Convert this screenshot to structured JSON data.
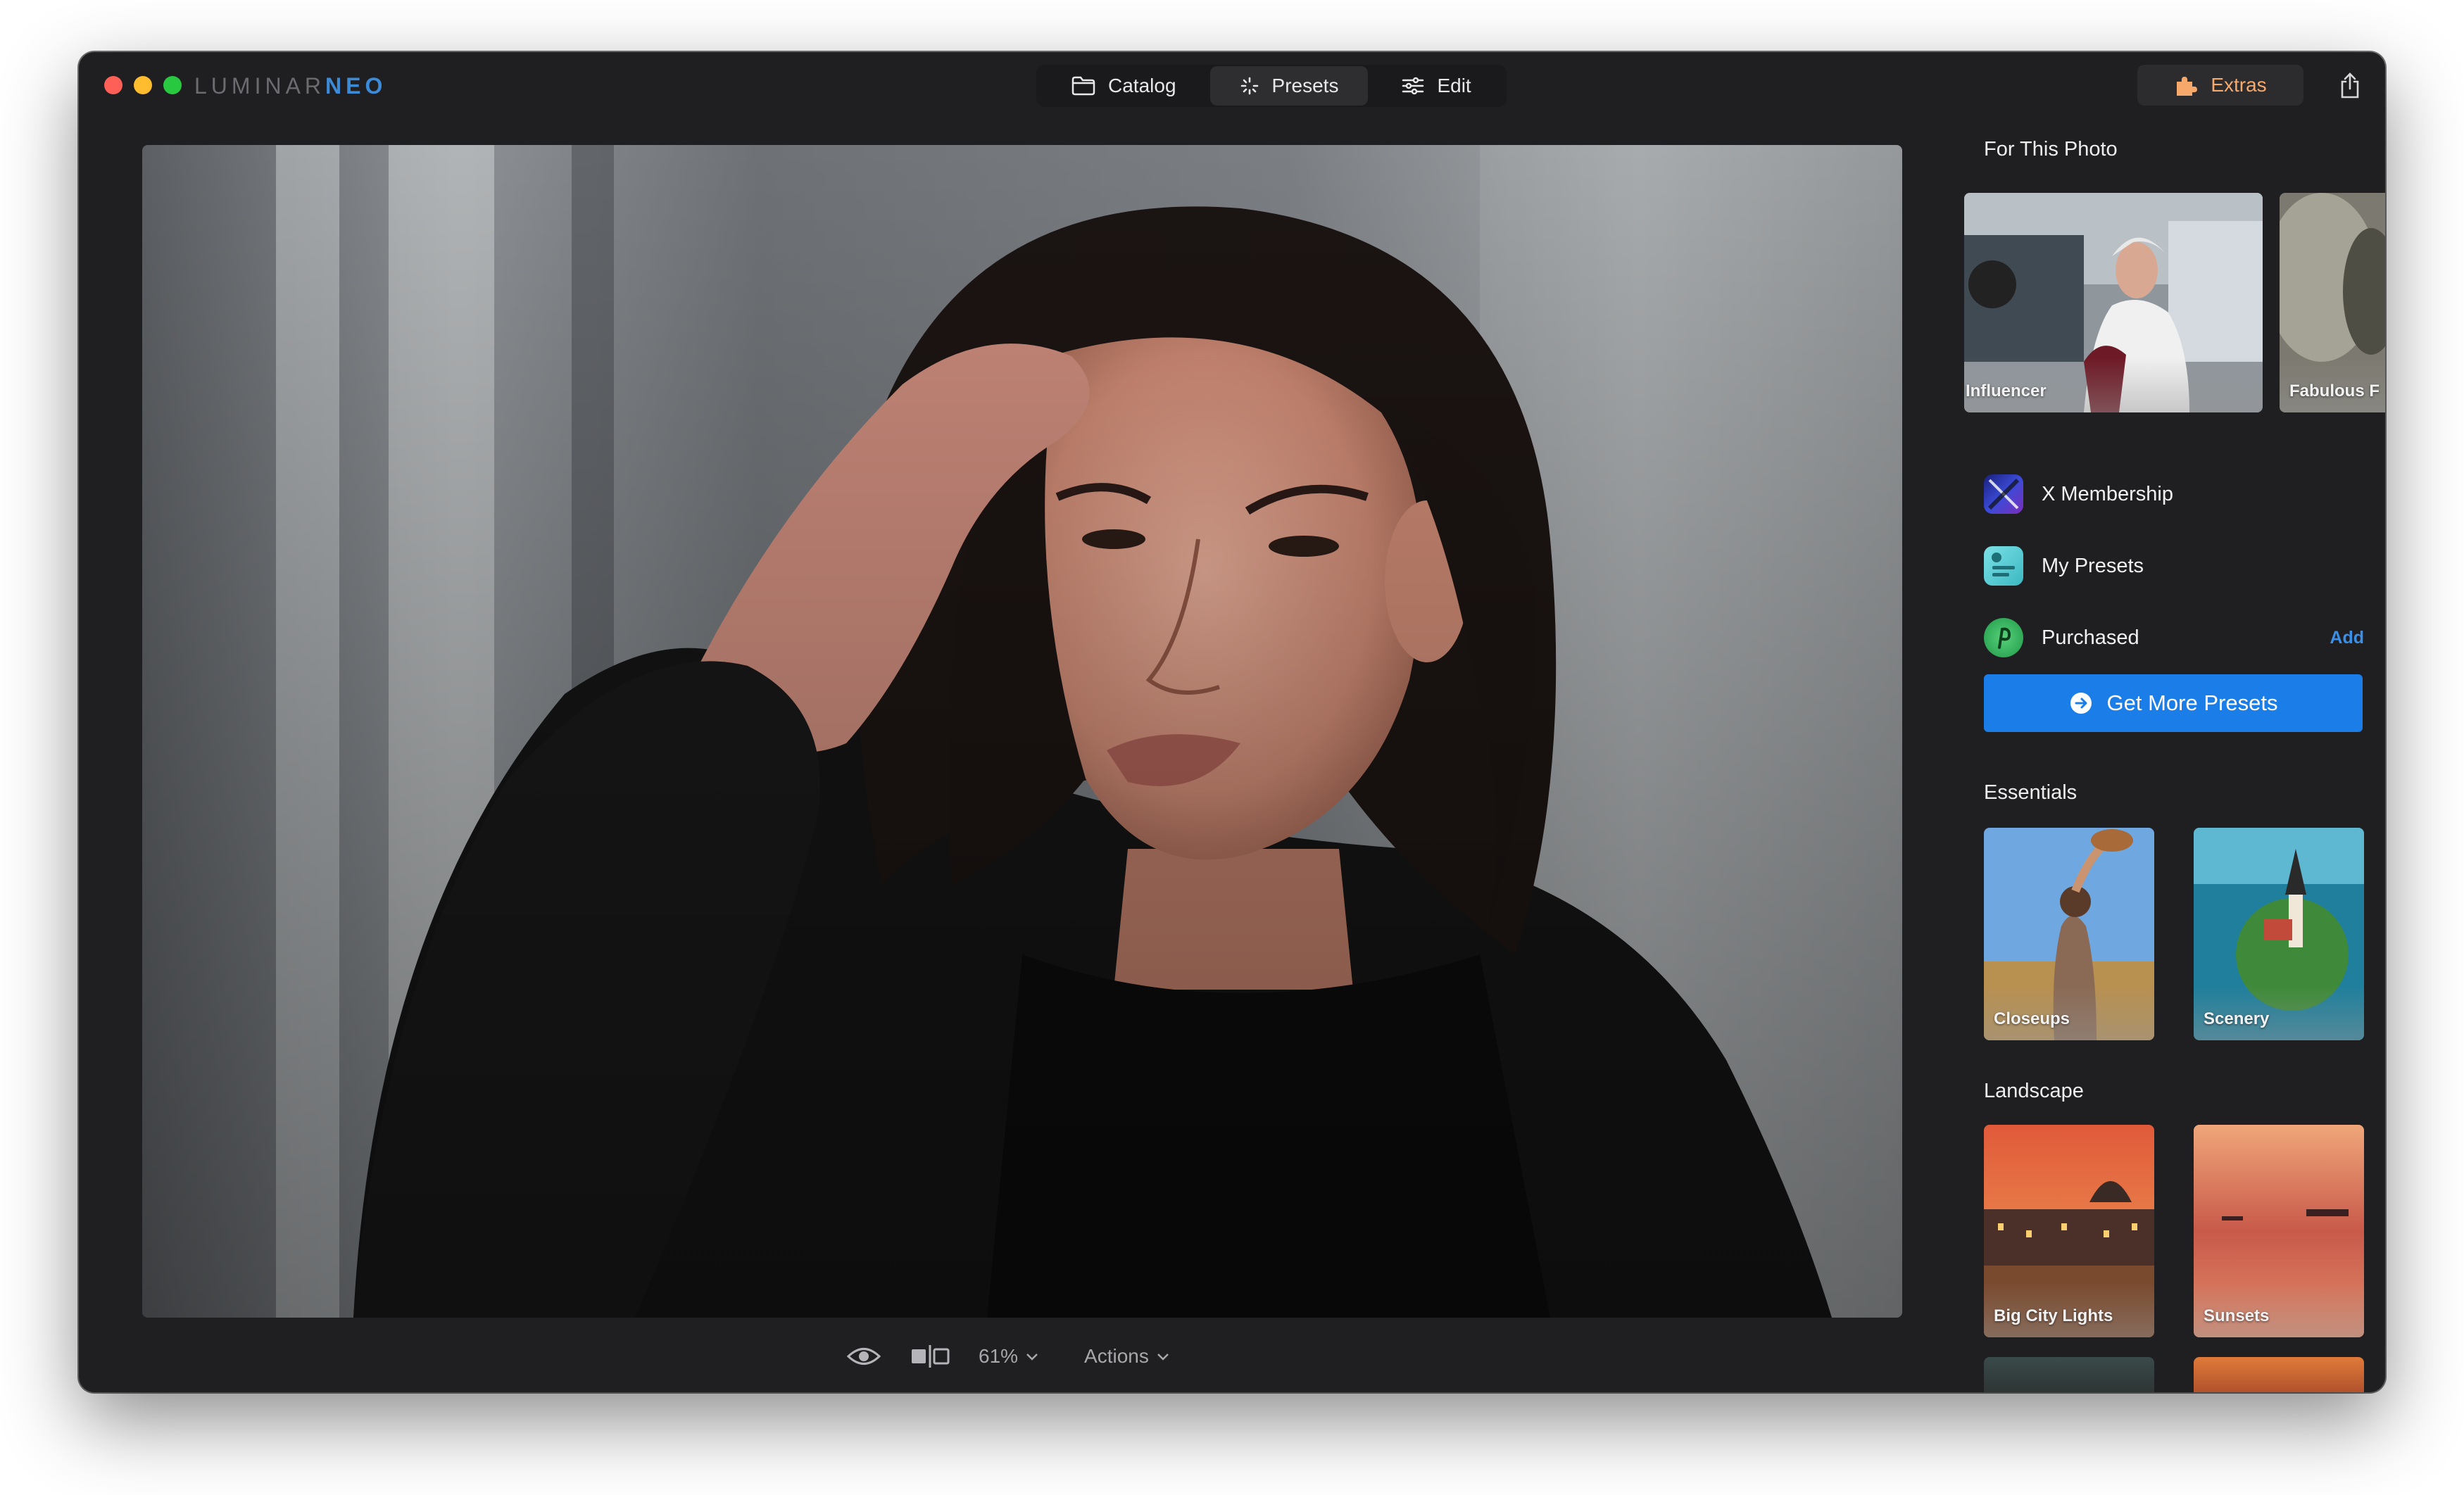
{
  "app": {
    "logo_main": "LUMINAR",
    "logo_accent": "NEO"
  },
  "topnav": {
    "catalog": "Catalog",
    "presets": "Presets",
    "edit": "Edit"
  },
  "extras": "Extras",
  "bottombar": {
    "zoom": "61%",
    "actions": "Actions"
  },
  "sidebar": {
    "for_this_photo": "For This Photo",
    "photo_presets": [
      "Influencer",
      "Fabulous F"
    ],
    "lists": {
      "x_membership": "X Membership",
      "my_presets": "My Presets",
      "purchased": "Purchased",
      "add": "Add"
    },
    "get_more": "Get More Presets",
    "essentials": "Essentials",
    "essentials_items": [
      "Closeups",
      "Scenery"
    ],
    "landscape": "Landscape",
    "landscape_items": [
      "Big City Lights",
      "Sunsets"
    ]
  },
  "colors": {
    "accent_blue": "#1b7de8",
    "extras_orange": "#f6a96b",
    "window_bg": "#1f1f21"
  },
  "icons": [
    "folder-icon",
    "presets-sparkle-icon",
    "sliders-icon",
    "puzzle-icon",
    "share-icon",
    "eye-icon",
    "compare-icon",
    "chevron-down-icon",
    "arrow-right-circle-icon"
  ]
}
